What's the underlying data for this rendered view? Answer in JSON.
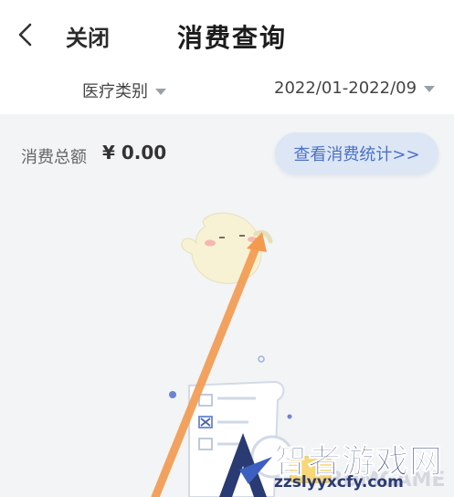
{
  "header": {
    "close_label": "关闭",
    "title": "消费查询"
  },
  "filters": {
    "category_label": "医疗类别",
    "date_range": "2022/01-2022/09"
  },
  "summary": {
    "total_label": "消费总额",
    "total_value": "¥ 0.00",
    "stats_button_label": "查看消费统计>>"
  },
  "watermark": {
    "title": "智者游戏网",
    "url": "zzslyyxcfy.com",
    "faint_text": "3DMGAME"
  },
  "colors": {
    "accent": "#4b73c4",
    "arrow": "#f39a4e",
    "watermark": "#2a3a73"
  }
}
